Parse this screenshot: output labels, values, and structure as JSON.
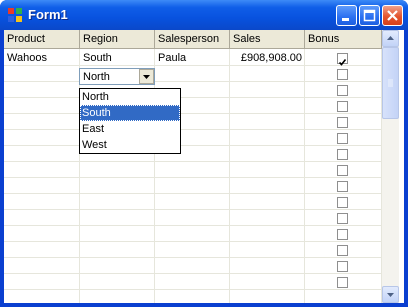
{
  "window": {
    "title": "Form1",
    "accent": "#0a3fd0",
    "icons": [
      "app-icon",
      "minimize-icon",
      "maximize-icon",
      "close-icon"
    ]
  },
  "grid": {
    "columns": [
      "Product",
      "Region",
      "Salesperson",
      "Sales",
      "Bonus"
    ],
    "rows": [
      {
        "product": "Wahoos",
        "region": "South",
        "salesperson": "Paula",
        "sales": "£908,908.00",
        "bonus": true
      }
    ],
    "empty_bonus_rows": 14
  },
  "editor": {
    "combo_value": "North",
    "options": [
      "North",
      "South",
      "East",
      "West"
    ],
    "highlighted": "South",
    "highlight_color": "#316ac5"
  }
}
